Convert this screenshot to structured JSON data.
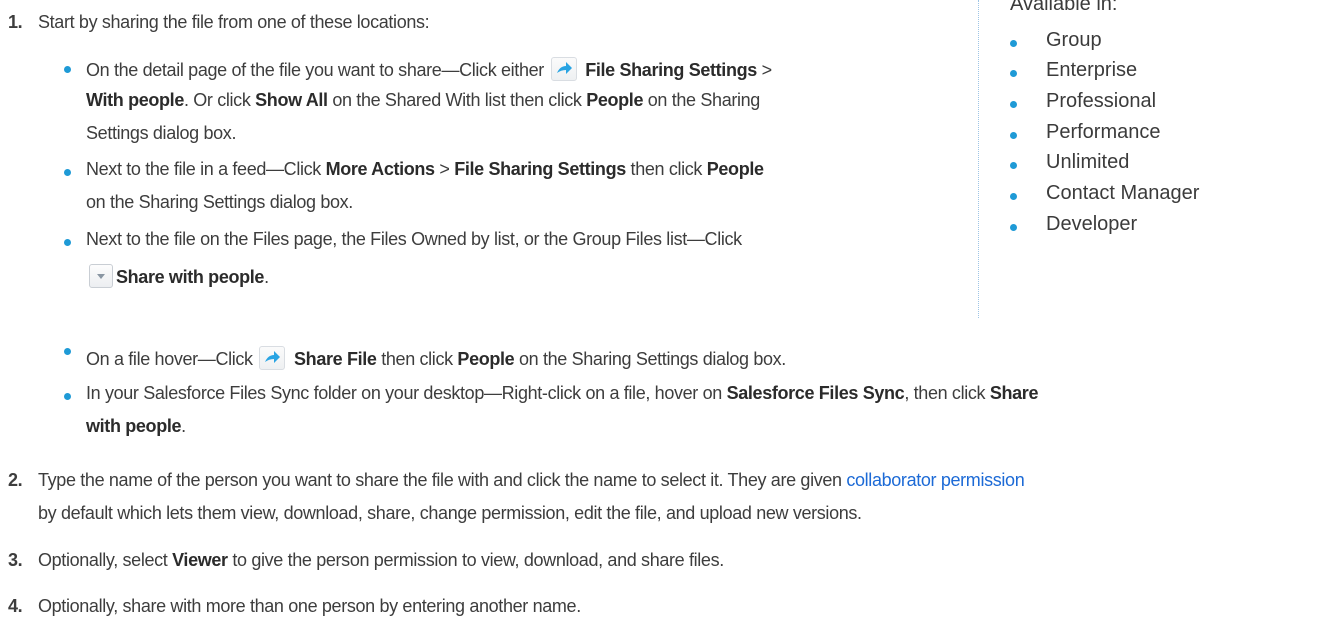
{
  "steps": [
    {
      "number": "1.",
      "text": "Start by sharing the file from one of these locations:",
      "items": [
        {
          "line1": {
            "a": "On the detail page of the file you want to share—Click either ",
            "icon": "share-icon",
            "b_bold": "File Sharing Settings",
            "c": " >"
          },
          "line2": {
            "a_bold": "With people",
            "b": ". Or click ",
            "c_bold": "Show All",
            "d": " on the Shared With list then click ",
            "e_bold": "People",
            "f": " on the Sharing"
          },
          "line3": "Settings dialog box."
        },
        {
          "line1": {
            "a": "Next to the file in a feed—Click ",
            "b_bold": "More Actions",
            "c": " > ",
            "d_bold": "File Sharing Settings",
            "e": " then click ",
            "f_bold": "People"
          },
          "line2": "on the Sharing Settings dialog box."
        },
        {
          "line1": "Next to the file on the Files page, the Files Owned by list, or the Group Files list—Click",
          "line2": {
            "icon": "dropdown-menu-icon",
            "a_bold": "Share with people",
            "b": "."
          }
        },
        {
          "line1": {
            "a": "On a file hover—Click ",
            "icon": "share-icon",
            "b_bold": "Share File",
            "c": " then click ",
            "d_bold": "People",
            "e": " on the Sharing Settings dialog box."
          }
        },
        {
          "line1": {
            "a": "In your Salesforce Files Sync folder on your desktop—Right-click on a file, hover on ",
            "b_bold": "Salesforce Files Sync",
            "c": ", then click ",
            "d_bold": "Share"
          },
          "line2": {
            "a_bold": "with people",
            "b": "."
          }
        }
      ]
    },
    {
      "number": "2.",
      "line1": {
        "a": "Type the name of the person you want to share the file with and click the name to select it. They are given ",
        "link": "collaborator permission"
      },
      "line2": "by default which lets them view, download, share, change permission, edit the file, and upload new versions."
    },
    {
      "number": "3.",
      "line1": {
        "a": "Optionally, select ",
        "b_bold": "Viewer",
        "c": " to give the person permission to view, download, and share files."
      }
    },
    {
      "number": "4.",
      "line1": "Optionally, share with more than one person by entering another name."
    }
  ],
  "sidebar": {
    "heading": "Available in:",
    "editions": [
      "Group",
      "Enterprise",
      "Professional",
      "Performance",
      "Unlimited",
      "Contact Manager",
      "Developer"
    ]
  },
  "colors": {
    "bullet": "#1e9ad6",
    "link": "#1c6ad6",
    "text": "#3d3d3d"
  }
}
